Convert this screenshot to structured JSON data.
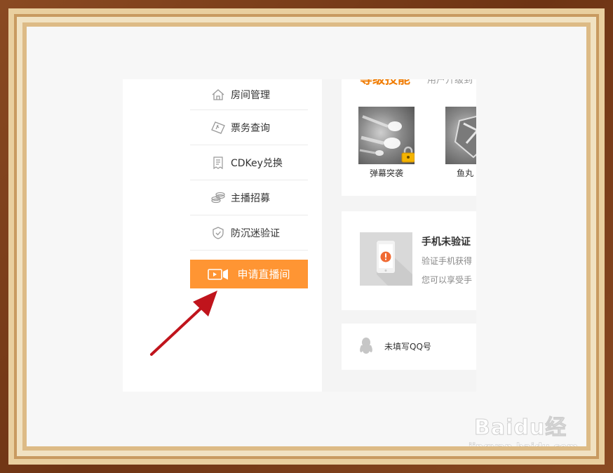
{
  "sidebar": {
    "items": [
      {
        "label": "房间管理",
        "icon": "house-icon"
      },
      {
        "label": "票务查询",
        "icon": "ticket-icon"
      },
      {
        "label": "CDKey兑换",
        "icon": "receipt-icon"
      },
      {
        "label": "主播招募",
        "icon": "coins-icon"
      },
      {
        "label": "防沉迷验证",
        "icon": "shield-icon"
      }
    ],
    "apply_button": {
      "label": "申请直播间",
      "icon": "video-camera-icon"
    }
  },
  "skills": {
    "title": "等级技能",
    "subtitle": "用户升级到",
    "items": [
      {
        "name": "弹幕突袭",
        "locked": true
      },
      {
        "name": "鱼丸",
        "locked": false
      }
    ]
  },
  "phone_card": {
    "title": "手机未验证",
    "line1": "验证手机获得",
    "line2": "您可以享受手",
    "icon": "phone-alert-icon"
  },
  "qq_card": {
    "text": "未填写QQ号",
    "icon": "qq-penguin-icon"
  },
  "annotation": {
    "color": "#c0141c",
    "icon": "red-arrow-icon"
  },
  "watermark": {
    "brand": "Baidu经验",
    "url": "jingyan.baidu.com"
  },
  "colors": {
    "accent": "#ff9533",
    "skills_title": "#f07b00",
    "frame": "#7a3f1c"
  }
}
